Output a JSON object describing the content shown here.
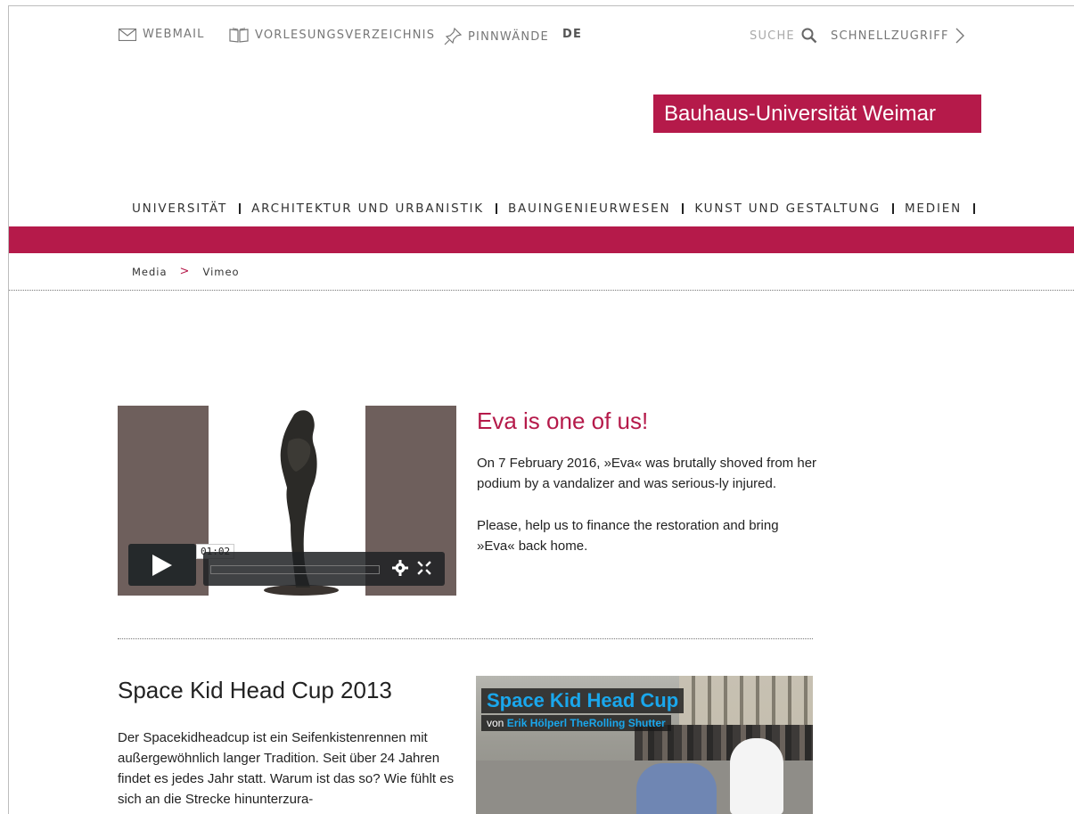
{
  "topbar": {
    "webmail": "WEBMAIL",
    "catalog": "VORLESUNGSVERZEICHNIS",
    "boards": "PINNWÄNDE",
    "language": "DE",
    "search": "SUCHE",
    "quickaccess": "SCHNELLZUGRIFF"
  },
  "logo": "Bauhaus-Universität Weimar",
  "mainnav": {
    "items": [
      "UNIVERSITÄT",
      "ARCHITEKTUR UND URBANISTIK",
      "BAUINGENIEURWESEN",
      "KUNST UND GESTALTUNG",
      "MEDIEN"
    ]
  },
  "breadcrumb": {
    "items": [
      "Media",
      "Vimeo"
    ],
    "separator": ">"
  },
  "article1": {
    "title": "Eva is one of us!",
    "paragraphs": [
      "On 7 February 2016, »Eva« was brutally shoved from her podium by a vandalizer and was serious-ly injured.",
      "Please, help us to finance the restoration and bring »Eva« back home."
    ],
    "video": {
      "timecode": "01:02"
    }
  },
  "article2": {
    "title": "Space Kid Head Cup 2013",
    "paragraph": "Der Spacekidheadcup ist ein Seifenkistenrennen mit außergewöhnlich langer Tradition. Seit über 24 Jahren findet es jedes Jahr statt. Warum ist das so? Wie fühlt es sich an die Strecke hinunterzura-",
    "video": {
      "title": "Space Kid Head Cup",
      "by_prefix": "von",
      "author": "Erik Hölperl TheRolling Shutter"
    }
  },
  "colors": {
    "brand": "#b51a4a",
    "video_panel": "#6e5f5c",
    "vimeo_blue": "#1aa7ec"
  },
  "icons": [
    "mail-icon",
    "book-icon",
    "pin-icon",
    "search-icon",
    "chevron-right-icon",
    "play-icon",
    "gear-icon",
    "fullscreen-icon"
  ]
}
